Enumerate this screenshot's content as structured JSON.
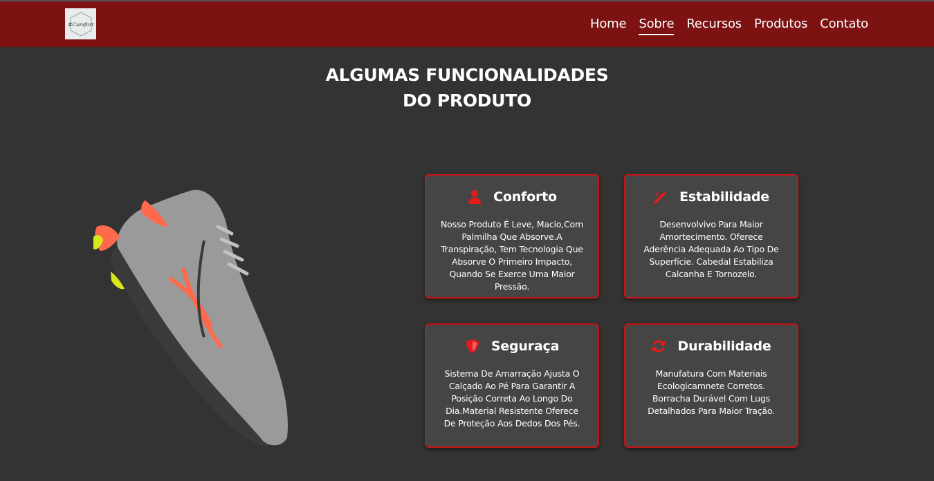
{
  "nav": {
    "logo_text": "#Comfort",
    "links": [
      {
        "label": "Home",
        "active": false
      },
      {
        "label": "Sobre",
        "active": true
      },
      {
        "label": "Recursos",
        "active": false
      },
      {
        "label": "Produtos",
        "active": false
      },
      {
        "label": "Contato",
        "active": false
      }
    ]
  },
  "section": {
    "title_line1": "ALGUMAS FUNCIONALIDADES",
    "title_line2": "DO PRODUTO"
  },
  "colors": {
    "navbar": "#7d1212",
    "background": "#333333",
    "card_bg": "#454545",
    "card_border": "#c81414",
    "icon": "#e31b1b"
  },
  "features": [
    {
      "icon": "user-icon",
      "title": "Conforto",
      "text": "Nosso Produto É Leve, Macio,Com Palmilha Que Absorve.A Transpiração, Tem Tecnologia Que Absorve O Primeiro Impacto, Quando Se Exerce Uma Maior Pressão."
    },
    {
      "icon": "magic-wand-icon",
      "title": "Estabilidade",
      "text": "Desenvolvivo Para Maior Amortecimento. Oferece Aderência Adequada Ao Tipo De Superfície. Cabedal Estabiliza Calcanha E Tornozelo."
    },
    {
      "icon": "shield-icon",
      "title": "Seguraça",
      "text": "Sistema De Amarração Ajusta O Calçado Ao Pé Para Garantir A Posição Correta Ao Longo Do Dia.Material Resistente Oferece De Proteção Aos Dedos Dos Pés."
    },
    {
      "icon": "refresh-icon",
      "title": "Durabilidade",
      "text": "Manufatura Com Materiais Ecologicamnete Corretos. Borracha Durável Com Lugs Detalhados Para Maior Tração."
    }
  ]
}
